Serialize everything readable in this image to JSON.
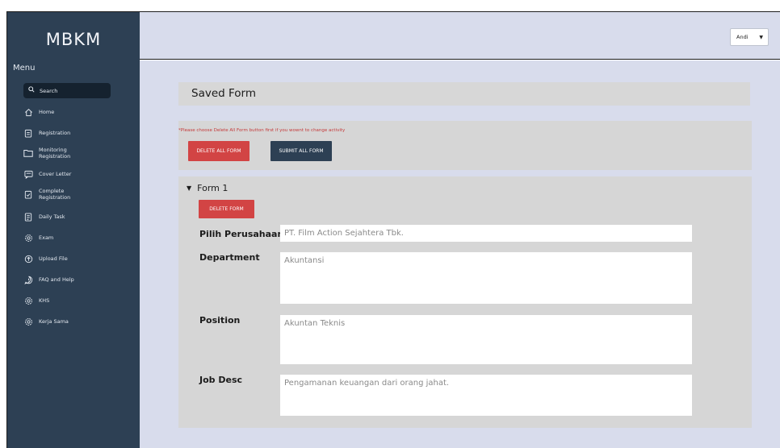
{
  "app": {
    "logo": "MBKM",
    "menu_label": "Menu"
  },
  "sidebar": {
    "search_label": "Search",
    "items": [
      {
        "label": "Home",
        "icon": "home-icon"
      },
      {
        "label": "Registration",
        "icon": "clipboard-icon"
      },
      {
        "label": "Monitoring",
        "label2": "Registration",
        "icon": "folder-icon"
      },
      {
        "label": "Cover Letter",
        "icon": "message-icon"
      },
      {
        "label": "Complete",
        "label2": "Registration",
        "icon": "clipboard-check-icon"
      },
      {
        "label": "Daily Task",
        "icon": "task-icon"
      },
      {
        "label": "Exam",
        "icon": "gear-icon"
      },
      {
        "label": "Upload File",
        "icon": "upload-icon"
      },
      {
        "label": "FAQ and Help",
        "icon": "help-icon"
      },
      {
        "label": "KHS",
        "icon": "gear-icon"
      },
      {
        "label": "Kerja Sama",
        "icon": "gear-icon"
      }
    ]
  },
  "topbar": {
    "user": "Andi"
  },
  "main": {
    "saved_title": "Saved Form",
    "warning": "*Please choose Delete All Form button first if you wownt to change activity",
    "delete_all_label": "DELETE ALL FORM",
    "submit_all_label": "SUBMIT ALL FORM",
    "form": {
      "title": "Form 1",
      "delete_label": "DELETE FORM",
      "fields": [
        {
          "label": "Pilih Perusahaan",
          "value": "PT. Film Action Sejahtera Tbk."
        },
        {
          "label": "Department",
          "value": "Akuntansi"
        },
        {
          "label": "Position",
          "value": "Akuntan Teknis"
        },
        {
          "label": "Job Desc",
          "value": "Pengamanan keuangan dari orang jahat."
        }
      ]
    }
  },
  "colors": {
    "sidebar": "#2d4054",
    "content_bg": "#d8dcec",
    "danger": "#d24444",
    "primary_dark": "#2d4054"
  }
}
